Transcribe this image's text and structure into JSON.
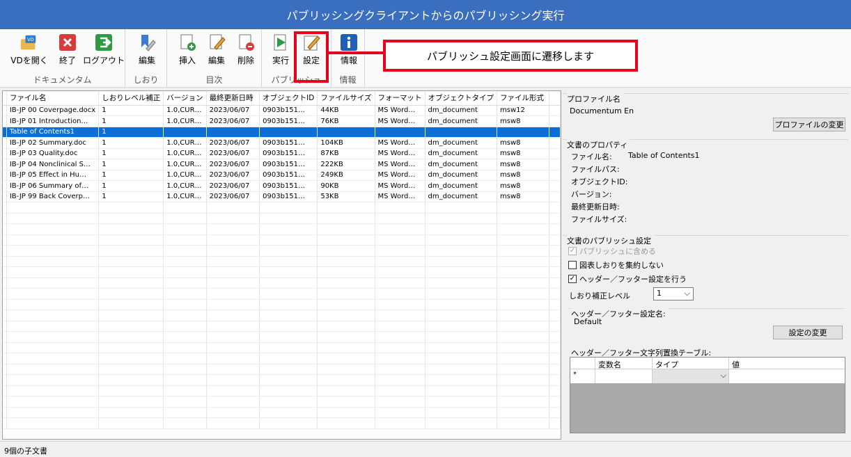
{
  "window": {
    "title": "パブリッシングクライアントからのパブリッシング実行"
  },
  "ribbon": {
    "groups": [
      {
        "label": "ドキュメンタム",
        "buttons": [
          {
            "label": "VDを開く",
            "icon": "vd-open-icon"
          },
          {
            "label": "終了",
            "icon": "close-red-icon"
          },
          {
            "label": "ログアウト",
            "icon": "logout-icon"
          }
        ]
      },
      {
        "label": "しおり",
        "buttons": [
          {
            "label": "編集",
            "icon": "bookmark-edit-icon"
          }
        ]
      },
      {
        "label": "目次",
        "buttons": [
          {
            "label": "挿入",
            "icon": "insert-icon"
          },
          {
            "label": "編集",
            "icon": "edit-icon"
          },
          {
            "label": "削除",
            "icon": "delete-icon"
          }
        ]
      },
      {
        "label": "パブリッシュ",
        "buttons": [
          {
            "label": "実行",
            "icon": "run-icon"
          },
          {
            "label": "設定",
            "icon": "settings-pencil-icon"
          }
        ]
      },
      {
        "label": "情報",
        "buttons": [
          {
            "label": "情報",
            "icon": "info-icon"
          }
        ]
      }
    ],
    "colors": {
      "title_bar": "#3a6fbf",
      "callout": "#e8001c",
      "selection": "#0a6fd6"
    }
  },
  "callout": {
    "text": "パブリッシュ設定画面に遷移します"
  },
  "grid": {
    "columns": [
      "ファイル名",
      "しおりレベル補正",
      "バージョン",
      "最終更新日時",
      "オブジェクトID",
      "ファイルサイズ",
      "フォーマット",
      "オブジェクトタイプ",
      "ファイル形式"
    ],
    "rows": [
      [
        "IB-JP 00 Coverpage.docx",
        "1",
        "1.0,CUR…",
        "2023/06/07",
        "0903b151…",
        "44KB",
        "MS Word…",
        "dm_document",
        "msw12"
      ],
      [
        "IB-JP 01 Introduction…",
        "1",
        "1.0,CUR…",
        "2023/06/07",
        "0903b151…",
        "76KB",
        "MS Word…",
        "dm_document",
        "msw8"
      ],
      [
        "Table of Contents1",
        "1",
        "",
        "",
        "",
        "",
        "",
        "",
        ""
      ],
      [
        "IB-JP 02 Summary.doc",
        "1",
        "1.0,CUR…",
        "2023/06/07",
        "0903b151…",
        "104KB",
        "MS Word…",
        "dm_document",
        "msw8"
      ],
      [
        "IB-JP 03 Quality.doc",
        "1",
        "1.0,CUR…",
        "2023/06/07",
        "0903b151…",
        "87KB",
        "MS Word…",
        "dm_document",
        "msw8"
      ],
      [
        "IB-JP 04 Nonclinical S…",
        "1",
        "1.0,CUR…",
        "2023/06/07",
        "0903b151…",
        "222KB",
        "MS Word…",
        "dm_document",
        "msw8"
      ],
      [
        "IB-JP 05 Effect in Hu…",
        "1",
        "1.0,CUR…",
        "2023/06/07",
        "0903b151…",
        "249KB",
        "MS Word…",
        "dm_document",
        "msw8"
      ],
      [
        "IB-JP 06 Summary of…",
        "1",
        "1.0,CUR…",
        "2023/06/07",
        "0903b151…",
        "90KB",
        "MS Word…",
        "dm_document",
        "msw8"
      ],
      [
        "IB-JP 99 Back Coverp…",
        "1",
        "1.0,CUR…",
        "2023/06/07",
        "0903b151…",
        "53KB",
        "MS Word…",
        "dm_document",
        "msw8"
      ]
    ],
    "selected_row": 2
  },
  "status": {
    "text": "9個の子文書"
  },
  "side": {
    "profile": {
      "title": "プロファイル名",
      "value": "Documentum En",
      "change_button": "プロファイルの変更"
    },
    "props": {
      "title": "文書のプロパティ",
      "labels": {
        "file_name": "ファイル名:",
        "file_path": "ファイルパス:",
        "object_id": "オブジェクトID:",
        "version": "バージョン:",
        "modified": "最終更新日時:",
        "file_size": "ファイルサイズ:"
      },
      "file_name_value": "Table of Contents1"
    },
    "publish": {
      "title": "文書のパブリッシュ設定",
      "include_publish": "パブリッシュに含める",
      "no_aggregate": "図表しおりを集約しない",
      "header_footer": "ヘッダー／フッター設定を行う",
      "level_label": "しおり補正レベル",
      "level_value": "1",
      "hf_name_title": "ヘッダー／フッター設定名:",
      "hf_name_value": "Default",
      "hf_change_button": "設定の変更",
      "table_title": "ヘッダー／フッター文字列置換テーブル:",
      "table_columns": [
        "変数名",
        "タイプ",
        "値"
      ],
      "new_row_marker": "*"
    }
  }
}
